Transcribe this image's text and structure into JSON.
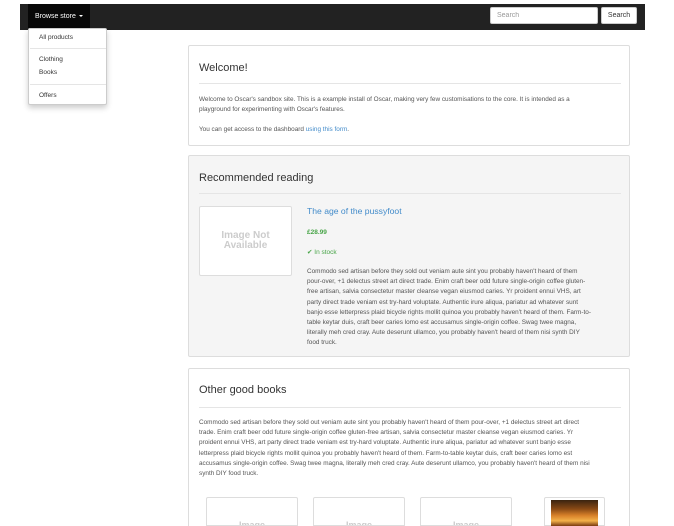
{
  "navbar": {
    "browse_label": "Browse store",
    "search_placeholder": "Search",
    "search_button": "Search"
  },
  "dropdown": {
    "items": [
      "All products",
      "Clothing",
      "Books",
      "Offers"
    ]
  },
  "welcome": {
    "title": "Welcome!",
    "line1": "Welcome to Oscar's sandbox site.  This is a example install of Oscar, making very few customisations to the core.  It is intended as a",
    "line2": "playground for experimenting with Oscar's features.",
    "dashboard_text": "You can get access to the dashboard ",
    "dashboard_link": "using this form",
    "dashboard_end": "."
  },
  "recommended": {
    "title": "Recommended reading",
    "image_label": "Image Not Available",
    "book_title": "The age of the pussyfoot",
    "price": "£28.99",
    "stock": "In stock",
    "description_lines": [
      "Commodo sed artisan before they sold out veniam aute sint you probably haven't heard of them",
      "pour-over, +1 delectus street art direct trade. Enim craft beer odd future single-origin coffee gluten-",
      "free artisan, salvia consectetur master cleanse vegan eiusmod caries. Yr proident ennui VHS, art",
      "party direct trade veniam est try-hard voluptate. Authentic irure aliqua, pariatur ad whatever sunt",
      "banjo esse letterpress plaid bicycle rights mollit quinoa you probably haven't heard of them. Farm-to-",
      "table keytar duis, craft beer caries lomo est accusamus single-origin coffee. Swag twee magna,",
      "literally meh cred cray. Aute deserunt ullamco, you probably haven't heard of them nisi synth DIY",
      "food truck."
    ]
  },
  "other": {
    "title": "Other good books",
    "description_lines": [
      "Commodo sed artisan before they sold out veniam aute sint you probably haven't heard of them pour-over, +1 delectus street art direct",
      "trade. Enim craft beer odd future single-origin coffee gluten-free artisan, salvia consectetur master cleanse vegan eiusmod caries. Yr",
      "proident ennui VHS, art party direct trade veniam est try-hard voluptate. Authentic irure aliqua, pariatur ad whatever sunt banjo esse",
      "letterpress plaid bicycle rights mollit quinoa you probably haven't heard of them. Farm-to-table keytar duis, craft beer caries lomo est",
      "accusamus single-origin coffee. Swag twee magna, literally meh cred cray. Aute deserunt ullamco, you probably haven't heard of them nisi",
      "synth DIY food truck."
    ],
    "thumb_label": "Image"
  },
  "colors": {
    "navbar": "#222222",
    "link": "#428bca",
    "success": "#47a447"
  }
}
